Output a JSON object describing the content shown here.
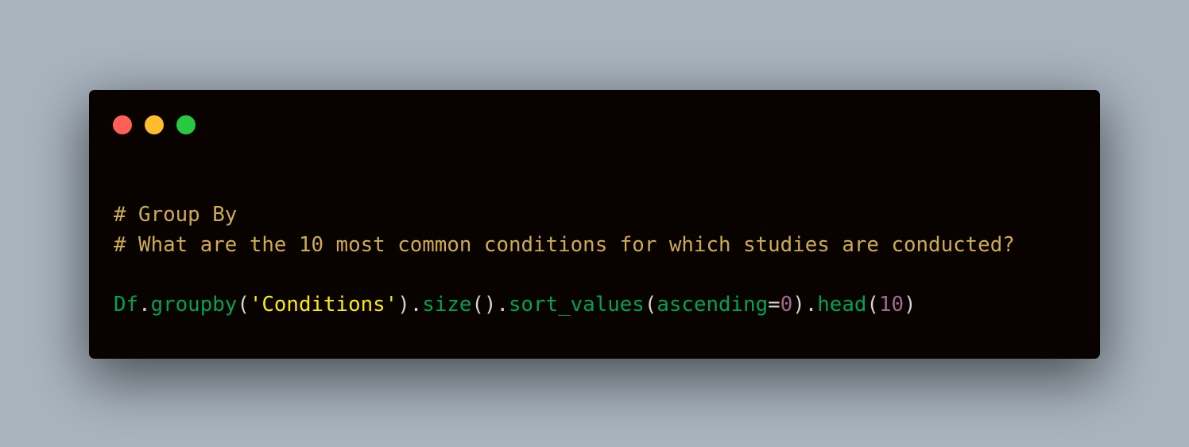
{
  "window": {
    "controls": [
      {
        "name": "close",
        "color": "#ff5f56"
      },
      {
        "name": "minimize",
        "color": "#ffbd2e"
      },
      {
        "name": "zoom",
        "color": "#27c93f"
      }
    ],
    "background": "#090300"
  },
  "code": {
    "comment_1": "# Group By",
    "comment_2": "# What are the 10 most common conditions for which studies are conducted?",
    "statement": {
      "var": "Df",
      "dot1": ".",
      "method1": "groupby",
      "paren1_open": "(",
      "string_arg": "'Conditions'",
      "paren1_close": ")",
      "dot2": ".",
      "method2": "size",
      "paren2": "()",
      "dot3": ".",
      "method3": "sort_values",
      "paren3_open": "(",
      "kwarg_name": "ascending",
      "equals": "=",
      "kwarg_value": "0",
      "paren3_close": ")",
      "dot4": ".",
      "method4": "head",
      "paren4_open": "(",
      "head_arg": "10",
      "paren4_close": ")"
    }
  },
  "colors": {
    "page_background": "#a9b4bf",
    "comment": "#cdab53",
    "name": "#01a252",
    "punctuation": "#d6d5d4",
    "string": "#fded02",
    "number": "#a16a94"
  }
}
